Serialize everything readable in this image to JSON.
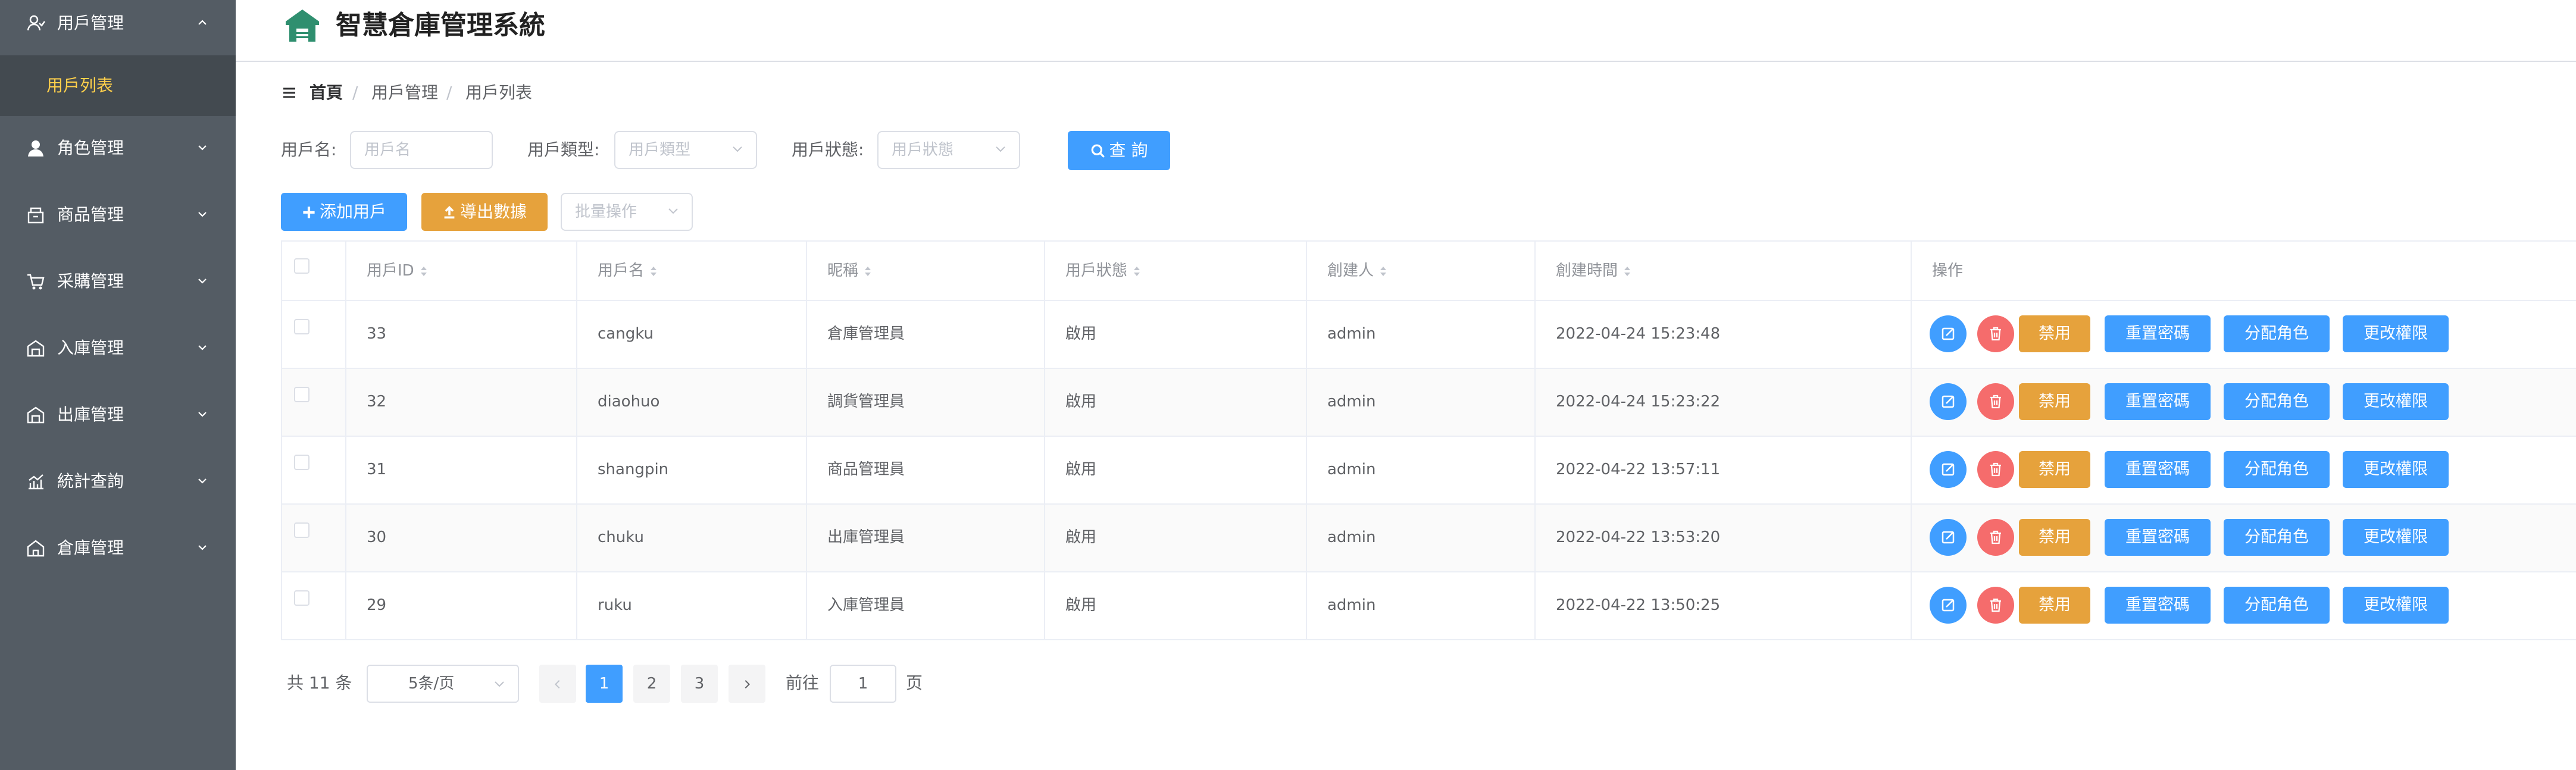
{
  "app": {
    "title": "智慧倉庫管理系統"
  },
  "sidebar": {
    "items": [
      {
        "label": "用戶管理",
        "icon": "user-manage-icon",
        "expanded": true
      },
      {
        "label": "角色管理",
        "icon": "role-icon"
      },
      {
        "label": "商品管理",
        "icon": "goods-icon"
      },
      {
        "label": "采購管理",
        "icon": "cart-icon"
      },
      {
        "label": "入庫管理",
        "icon": "inbound-icon"
      },
      {
        "label": "出庫管理",
        "icon": "outbound-icon"
      },
      {
        "label": "統計查詢",
        "icon": "stats-icon"
      },
      {
        "label": "倉庫管理",
        "icon": "warehouse-icon"
      }
    ],
    "sub_active": "用戶列表"
  },
  "breadcrumb": {
    "home": "首頁",
    "sep": "/",
    "level1": "用戶管理",
    "level2": "用戶列表"
  },
  "filters": {
    "username_label": "用戶名:",
    "username_placeholder": "用戶名",
    "type_label": "用戶類型:",
    "type_placeholder": "用戶類型",
    "status_label": "用戶狀態:",
    "status_placeholder": "用戶狀態",
    "search_label": "查 詢"
  },
  "toolbar": {
    "add_label": "添加用戶",
    "export_label": "導出數據",
    "batch_placeholder": "批量操作"
  },
  "table": {
    "columns": [
      "用戶ID",
      "用戶名",
      "昵稱",
      "用戶狀態",
      "創建人",
      "創建時間",
      "操作"
    ],
    "rows": [
      {
        "id": "33",
        "username": "cangku",
        "nickname": "倉庫管理員",
        "status": "啟用",
        "creator": "admin",
        "created": "2022-04-24 15:23:48"
      },
      {
        "id": "32",
        "username": "diaohuo",
        "nickname": "調貨管理員",
        "status": "啟用",
        "creator": "admin",
        "created": "2022-04-24 15:23:22"
      },
      {
        "id": "31",
        "username": "shangpin",
        "nickname": "商品管理員",
        "status": "啟用",
        "creator": "admin",
        "created": "2022-04-22 13:57:11"
      },
      {
        "id": "30",
        "username": "chuku",
        "nickname": "出庫管理員",
        "status": "啟用",
        "creator": "admin",
        "created": "2022-04-22 13:53:20"
      },
      {
        "id": "29",
        "username": "ruku",
        "nickname": "入庫管理員",
        "status": "啟用",
        "creator": "admin",
        "created": "2022-04-22 13:50:25"
      }
    ],
    "actions": {
      "disable": "禁用",
      "reset_pwd": "重置密碼",
      "assign_role": "分配角色",
      "change_perm": "更改權限"
    }
  },
  "pagination": {
    "total_text": "共 11 条",
    "page_size": "5条/页",
    "pages": [
      "1",
      "2",
      "3"
    ],
    "current": "1",
    "goto_label": "前往",
    "goto_value": "1",
    "goto_suffix": "页"
  },
  "colors": {
    "sidebar_bg": "#545c64",
    "sidebar_active": "#ffd04b",
    "primary": "#409eff",
    "warning": "#e6a23c",
    "danger": "#f56c6c",
    "logo": "#2f8f6f"
  }
}
